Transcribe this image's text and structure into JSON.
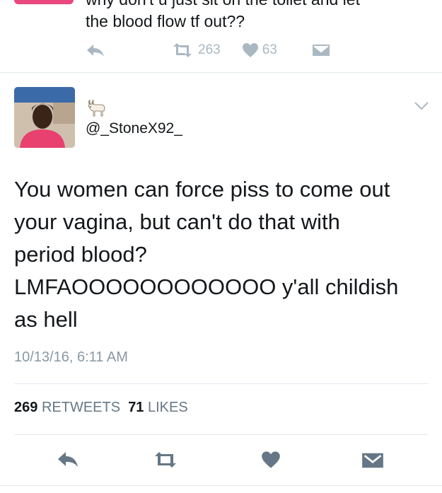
{
  "previous_tweet": {
    "text_partial_line": "why don't u just sit on the toilet and let",
    "text_line": "the blood flow tf out??",
    "retweets": "263",
    "likes": "63"
  },
  "tweet": {
    "emoji": "goat",
    "handle": "@_StoneX92_",
    "text": "You women can force piss to come out\nyour vagina, but can't do that with\nperiod blood?\nLMFAOOOOOOOOOOOO y'all childish\nas hell",
    "timestamp": "10/13/16, 6:11 AM",
    "retweet_count": "269",
    "retweet_label": "RETWEETS",
    "like_count": "71",
    "like_label": "LIKES"
  },
  "colors": {
    "icon_gray": "#aab8c2",
    "action_dark": "#657786",
    "text": "#14171a",
    "muted": "#8899a6"
  }
}
